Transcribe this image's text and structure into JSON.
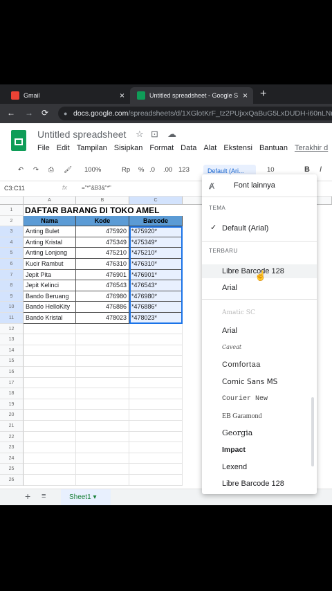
{
  "browser": {
    "tab1_label": "Gmail",
    "tab2_label": "Untitled spreadsheet - Google S",
    "close": "×",
    "newtab": "+",
    "url_host": "docs.google.com",
    "url_path": "/spreadsheets/d/1XGlotKrF_tz2PUjxxQaBuG5LxDUDH-i60nLNm"
  },
  "doc": {
    "title": "Untitled spreadsheet",
    "menu": [
      "File",
      "Edit",
      "Tampilan",
      "Sisipkan",
      "Format",
      "Data",
      "Alat",
      "Ekstensi",
      "Bantuan"
    ],
    "last_edit": "Terakhir d"
  },
  "toolbar": {
    "zoom": "100%",
    "currency": "Rp",
    "percent": "%",
    "dec_minus": ".0",
    "dec_plus": ".00",
    "format123": "123",
    "font": "Default (Ari...",
    "size": "10",
    "bold": "B",
    "italic": "I"
  },
  "formula": {
    "namebox": "C3:C11",
    "fx": "fx",
    "text": "=\"*\"&B3&\"*\""
  },
  "grid": {
    "columns": [
      "A",
      "B",
      "C"
    ],
    "rows": [
      "1",
      "2",
      "3",
      "4",
      "5",
      "6",
      "7",
      "8",
      "9",
      "10",
      "11",
      "12",
      "13",
      "14",
      "15",
      "16",
      "17",
      "18",
      "19",
      "20",
      "21",
      "22",
      "23",
      "24",
      "25",
      "26"
    ],
    "title": "DAFTAR BARANG DI TOKO AMEL",
    "headers": [
      "Nama",
      "Kode",
      "Barcode"
    ],
    "data": [
      [
        "Anting Bulet",
        "475920",
        "*475920*"
      ],
      [
        "Anting Kristal",
        "475349",
        "*475349*"
      ],
      [
        "Anting Lonjong",
        "475210",
        "*475210*"
      ],
      [
        "Kucir Rambut",
        "476310",
        "*476310*"
      ],
      [
        "Jepit Pita",
        "476901",
        "*476901*"
      ],
      [
        "Jepit Kelinci",
        "476543",
        "*476543*"
      ],
      [
        "Bando Beruang",
        "476980",
        "*476980*"
      ],
      [
        "Bando HelloKity",
        "476886",
        "*476886*"
      ],
      [
        "Bando Kristal",
        "478023",
        "*478023*"
      ]
    ]
  },
  "sheets": {
    "add": "+",
    "tab": "Sheet1"
  },
  "dropdown": {
    "more_fonts": "Font lainnya",
    "theme_label": "TEMA",
    "theme_default": "Default (Arial)",
    "recent_label": "TERBARU",
    "recent": [
      "Libre Barcode 128",
      "Arial"
    ],
    "fonts": [
      "Amatic SC",
      "Arial",
      "Caveat",
      "Comfortaa",
      "Comic Sans MS",
      "Courier New",
      "EB Garamond",
      "Georgia",
      "Impact",
      "Lexend",
      "Libre Barcode 128"
    ]
  }
}
